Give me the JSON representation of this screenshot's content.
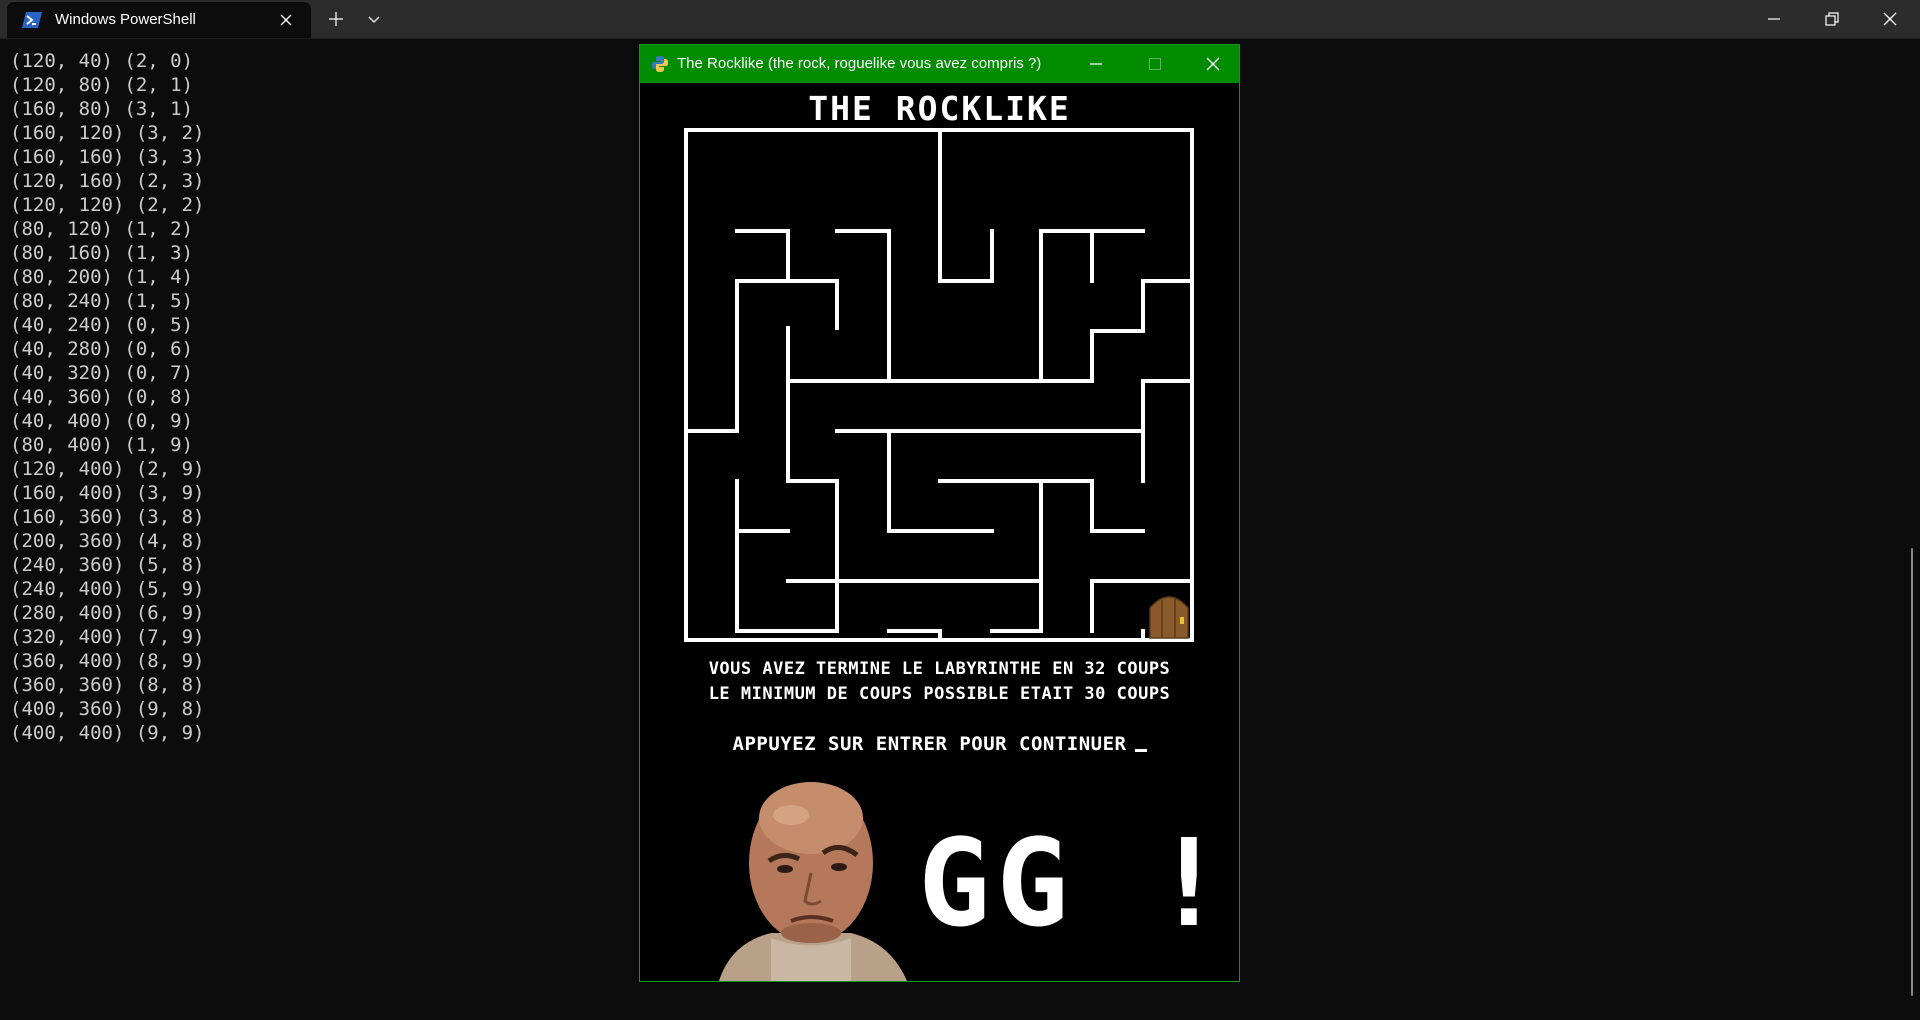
{
  "terminal": {
    "tab_title": "Windows PowerShell",
    "tab_icon": "powershell-icon",
    "lines": [
      "(120, 40) (2, 0)",
      "(120, 80) (2, 1)",
      "(160, 80) (3, 1)",
      "(160, 120) (3, 2)",
      "(160, 160) (3, 3)",
      "(120, 160) (2, 3)",
      "(120, 120) (2, 2)",
      "(80, 120) (1, 2)",
      "(80, 160) (1, 3)",
      "(80, 200) (1, 4)",
      "(80, 240) (1, 5)",
      "(40, 240) (0, 5)",
      "(40, 280) (0, 6)",
      "(40, 320) (0, 7)",
      "(40, 360) (0, 8)",
      "(40, 400) (0, 9)",
      "(80, 400) (1, 9)",
      "(120, 400) (2, 9)",
      "(160, 400) (3, 9)",
      "(160, 360) (3, 8)",
      "(200, 360) (4, 8)",
      "(240, 360) (5, 8)",
      "(240, 400) (5, 9)",
      "(280, 400) (6, 9)",
      "(320, 400) (7, 9)",
      "(360, 400) (8, 9)",
      "(360, 360) (8, 8)",
      "(400, 360) (9, 8)",
      "(400, 400) (9, 9)"
    ]
  },
  "game": {
    "window_title": "The Rocklike (the rock, roguelike vous avez compris ?)",
    "window_icon": "python-icon",
    "heading": "THE ROCKLIKE",
    "result_line_1": "VOUS AVEZ TERMINE LE LABYRINTHE EN 32 COUPS",
    "result_line_2": "LE MINIMUM DE COUPS POSSIBLE ETAIT 30 COUPS",
    "prompt": "APPUYEZ SUR ENTRER POUR CONTINUER",
    "gg": "GG !",
    "exit_icon": "door-icon",
    "photo": "the-rock-eyebrow-photo"
  },
  "colors": {
    "terminal_bg": "#0c0c0c",
    "game_titlebar": "#008c00",
    "maze_walls": "#ffffff"
  }
}
